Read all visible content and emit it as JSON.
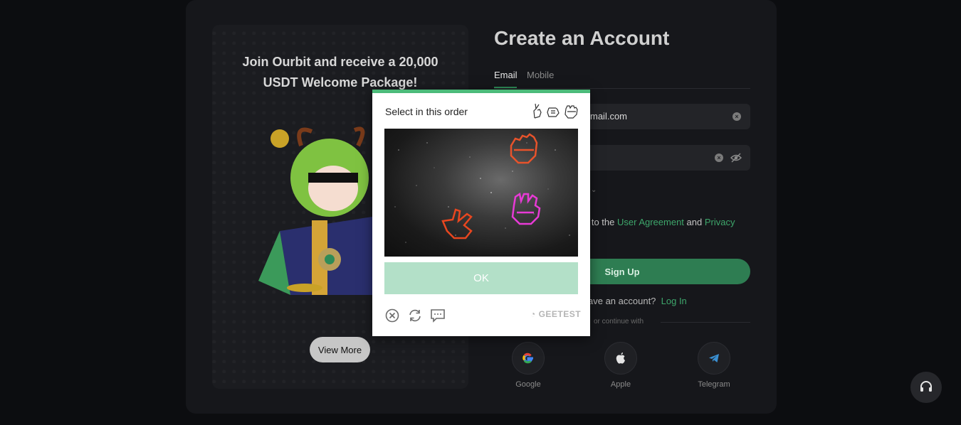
{
  "promo": {
    "title_line1": "Join Ourbit and receive a 20,000",
    "title_line2": "USDT Welcome Package!",
    "view_more_label": "View More"
  },
  "form": {
    "title": "Create an Account",
    "tabs": [
      {
        "label": "Email",
        "active": true
      },
      {
        "label": "Mobile",
        "active": false
      }
    ],
    "email_value_visible": "mail.com",
    "agreement_prefix": "e to the ",
    "user_agreement_link": "User Agreement",
    "and_text": " and ",
    "privacy_link": "Privacy",
    "signup_label": "Sign Up",
    "have_account_text": "ave an account?",
    "login_label": "Log In",
    "continue_text": "or continue with",
    "social": [
      {
        "label": "Google",
        "icon": "google-icon"
      },
      {
        "label": "Apple",
        "icon": "apple-icon"
      },
      {
        "label": "Telegram",
        "icon": "telegram-icon"
      }
    ]
  },
  "captcha": {
    "prompt": "Select in this order",
    "order_icons": [
      "peace-hand-icon",
      "pointing-hand-icon",
      "fist-hand-icon"
    ],
    "ok_label": "OK",
    "brand": "GEETEST",
    "colors": {
      "bar": "#4cbb7a",
      "ok_bg": "#b3e0c8"
    }
  },
  "accent_color": "#2e7d52"
}
